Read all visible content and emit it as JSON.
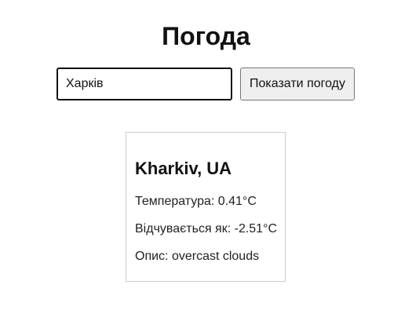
{
  "header": {
    "title": "Погода"
  },
  "search": {
    "value": "Харків",
    "button_label": "Показати погоду"
  },
  "weather": {
    "city": "Kharkiv, UA",
    "temperature": "Температура: 0.41°C",
    "feels_like": "Відчувається як: -2.51°C",
    "description": "Опис: overcast clouds"
  }
}
